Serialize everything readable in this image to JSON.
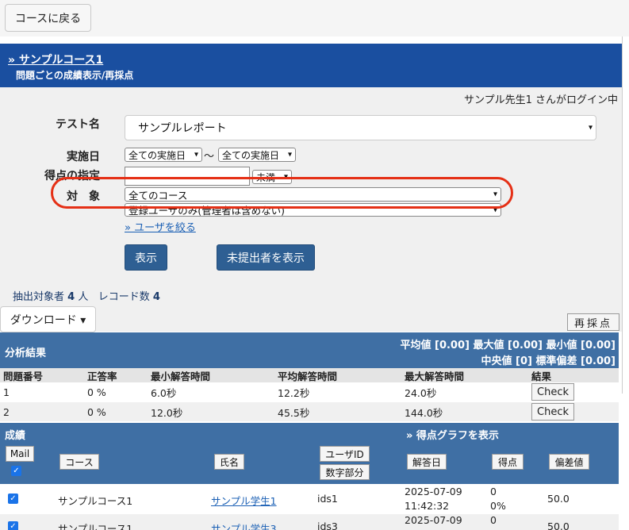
{
  "topbar": {
    "back_label": "コースに戻る"
  },
  "header": {
    "course_link": "» サンプルコース1",
    "subtitle": "問題ごとの成績表示/再採点"
  },
  "login_text": "サンプル先生1 さんがログイン中",
  "form": {
    "test_label": "テスト名",
    "test_value": "サンプルレポート",
    "date_label": "実施日",
    "date_from": "全ての実施日",
    "date_sep": "〜",
    "date_to": "全ての実施日",
    "score_label": "得点の指定",
    "score_value": "",
    "score_cond": "未満",
    "target_label": "対　象",
    "target_course": "全てのコース",
    "target_users": "登録ユーザのみ(管理者は含めない)",
    "filter_link": "» ユーザを絞る",
    "show_button": "表示",
    "unsubmitted_button": "未提出者を表示"
  },
  "summary": {
    "prefix": "抽出対象者",
    "count": "4",
    "unit": "人",
    "records_label": "レコード数",
    "records": "4"
  },
  "download_label": "ダウンロード ▾",
  "rescore_label": "再採点",
  "analysis": {
    "title": "分析結果",
    "stats_line1": "平均値 [0.00]  最大値 [0.00]  最小値 [0.00]",
    "stats_line2": "中央値 [0]  標準偏差 [0.00]",
    "headers": [
      "問題番号",
      "正答率",
      "最小解答時間",
      "平均解答時間",
      "最大解答時間",
      "結果"
    ],
    "rows": [
      {
        "num": "1",
        "rate": "0 %",
        "min": "6.0秒",
        "avg": "12.2秒",
        "max": "24.0秒",
        "action": "Check"
      },
      {
        "num": "2",
        "rate": "0 %",
        "min": "12.0秒",
        "avg": "45.5秒",
        "max": "144.0秒",
        "action": "Check"
      }
    ]
  },
  "grades": {
    "title": "成績",
    "graph_link": "» 得点グラフを表示",
    "mail_label": "Mail",
    "course_btn": "コース",
    "name_btn": "氏名",
    "userid_btn": "ユーザID",
    "numeric_btn": "数字部分",
    "date_btn": "解答日",
    "score_btn": "得点",
    "dev_btn": "偏差値",
    "rows": [
      {
        "course": "サンプルコース1",
        "name": "サンプル学生1",
        "uid": "ids1",
        "date": "2025-07-09",
        "time": "11:42:32",
        "score": "0",
        "pct": "0%",
        "dev": "50.0"
      },
      {
        "course": "サンプルコース1",
        "name": "サンプル学生3",
        "uid": "ids3",
        "date": "2025-07-09",
        "time": "",
        "score": "0",
        "pct": "",
        "dev": "50.0"
      }
    ]
  },
  "colors": {
    "header_blue": "#1a4fa0",
    "section_blue": "#3f6fa4",
    "button_blue": "#2e5f93",
    "highlight_red": "#e53016",
    "link_blue": "#1a5fb4"
  }
}
